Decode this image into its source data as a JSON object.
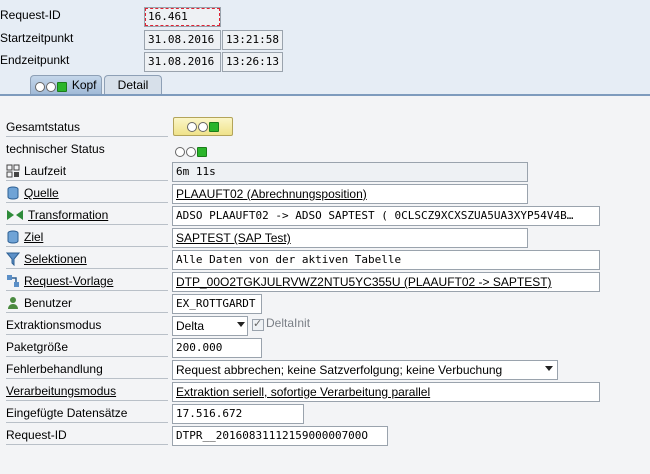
{
  "header": {
    "request_id_label": "Request-ID",
    "request_id_value": "16.461",
    "start_label": "Startzeitpunkt",
    "start_date": "31.08.2016",
    "start_time": "13:21:58",
    "end_label": "Endzeitpunkt",
    "end_date": "31.08.2016",
    "end_time": "13:26:13"
  },
  "tabs": [
    {
      "label": "Kopf",
      "active": true
    },
    {
      "label": "Detail",
      "active": false
    }
  ],
  "rows": {
    "gesamtstatus": {
      "label": "Gesamtstatus"
    },
    "tech_status": {
      "label": "technischer Status"
    },
    "laufzeit": {
      "label": "Laufzeit",
      "icon": "runtime-icon",
      "value": "6m 11s"
    },
    "quelle": {
      "label": "Quelle",
      "icon": "database-icon",
      "value": "PLAAUFT02 (Abrechnungsposition)"
    },
    "transformation": {
      "label": "Transformation",
      "icon": "transformation-icon",
      "value": "ADSO PLAAUFT02 -> ADSO SAPTEST ( 0CLSCZ9XCXSZUA5UA3XYP54V4B…"
    },
    "ziel": {
      "label": "Ziel",
      "icon": "database-icon",
      "value": "SAPTEST (SAP Test)"
    },
    "selektionen": {
      "label": "Selektionen",
      "icon": "filter-icon",
      "value": "Alle Daten von der aktiven Tabelle"
    },
    "request_vorlage": {
      "label": "Request-Vorlage",
      "icon": "dtp-icon",
      "value": "DTP_00O2TGKJULRVWZ2NTU5YC355U (PLAAUFT02 -> SAPTEST)"
    },
    "benutzer": {
      "label": "Benutzer",
      "icon": "user-icon",
      "value": "EX_ROTTGARDT"
    },
    "extraktionsmodus": {
      "label": "Extraktionsmodus",
      "value": "Delta",
      "checkbox_label": "DeltaInit"
    },
    "paketgroesse": {
      "label": "Paketgröße",
      "value": "200.000"
    },
    "fehlerbehandlung": {
      "label": "Fehlerbehandlung",
      "value": "Request abbrechen; keine Satzverfolgung; keine Verbuchung"
    },
    "verarbeitungsmodus": {
      "label": "Verarbeitungsmodus",
      "value": "Extraktion seriell, sofortige Verarbeitung parallel"
    },
    "eingefuegte": {
      "label": "Eingefügte Datensätze",
      "value": "17.516.672"
    },
    "request_id2": {
      "label": "Request-ID",
      "value": "DTPR__2016083111215900000700O"
    }
  }
}
